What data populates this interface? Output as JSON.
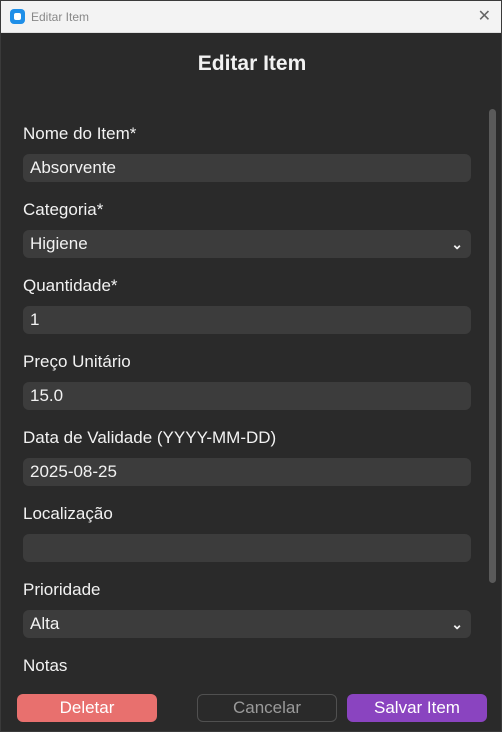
{
  "window": {
    "title": "Editar Item",
    "close_glyph": "✕"
  },
  "dialog": {
    "title": "Editar Item"
  },
  "fields": [
    {
      "label": "Nome do Item*",
      "value": "Absorvente",
      "type": "text"
    },
    {
      "label": "Categoria*",
      "value": "Higiene",
      "type": "select"
    },
    {
      "label": "Quantidade*",
      "value": "1",
      "type": "text"
    },
    {
      "label": "Preço Unitário",
      "value": "15.0",
      "type": "text"
    },
    {
      "label": "Data de Validade (YYYY-MM-DD)",
      "value": "2025-08-25",
      "type": "text"
    },
    {
      "label": "Localização",
      "value": "",
      "type": "text"
    },
    {
      "label": "Prioridade",
      "value": "Alta",
      "type": "select"
    },
    {
      "label": "Notas",
      "value": "",
      "type": "text"
    }
  ],
  "buttons": {
    "delete": "Deletar",
    "cancel": "Cancelar",
    "save": "Salvar Item"
  },
  "colors": {
    "background": "#2a2a2a",
    "input": "#3c3c3c",
    "delete": "#e8706e",
    "save": "#8a44c0"
  }
}
